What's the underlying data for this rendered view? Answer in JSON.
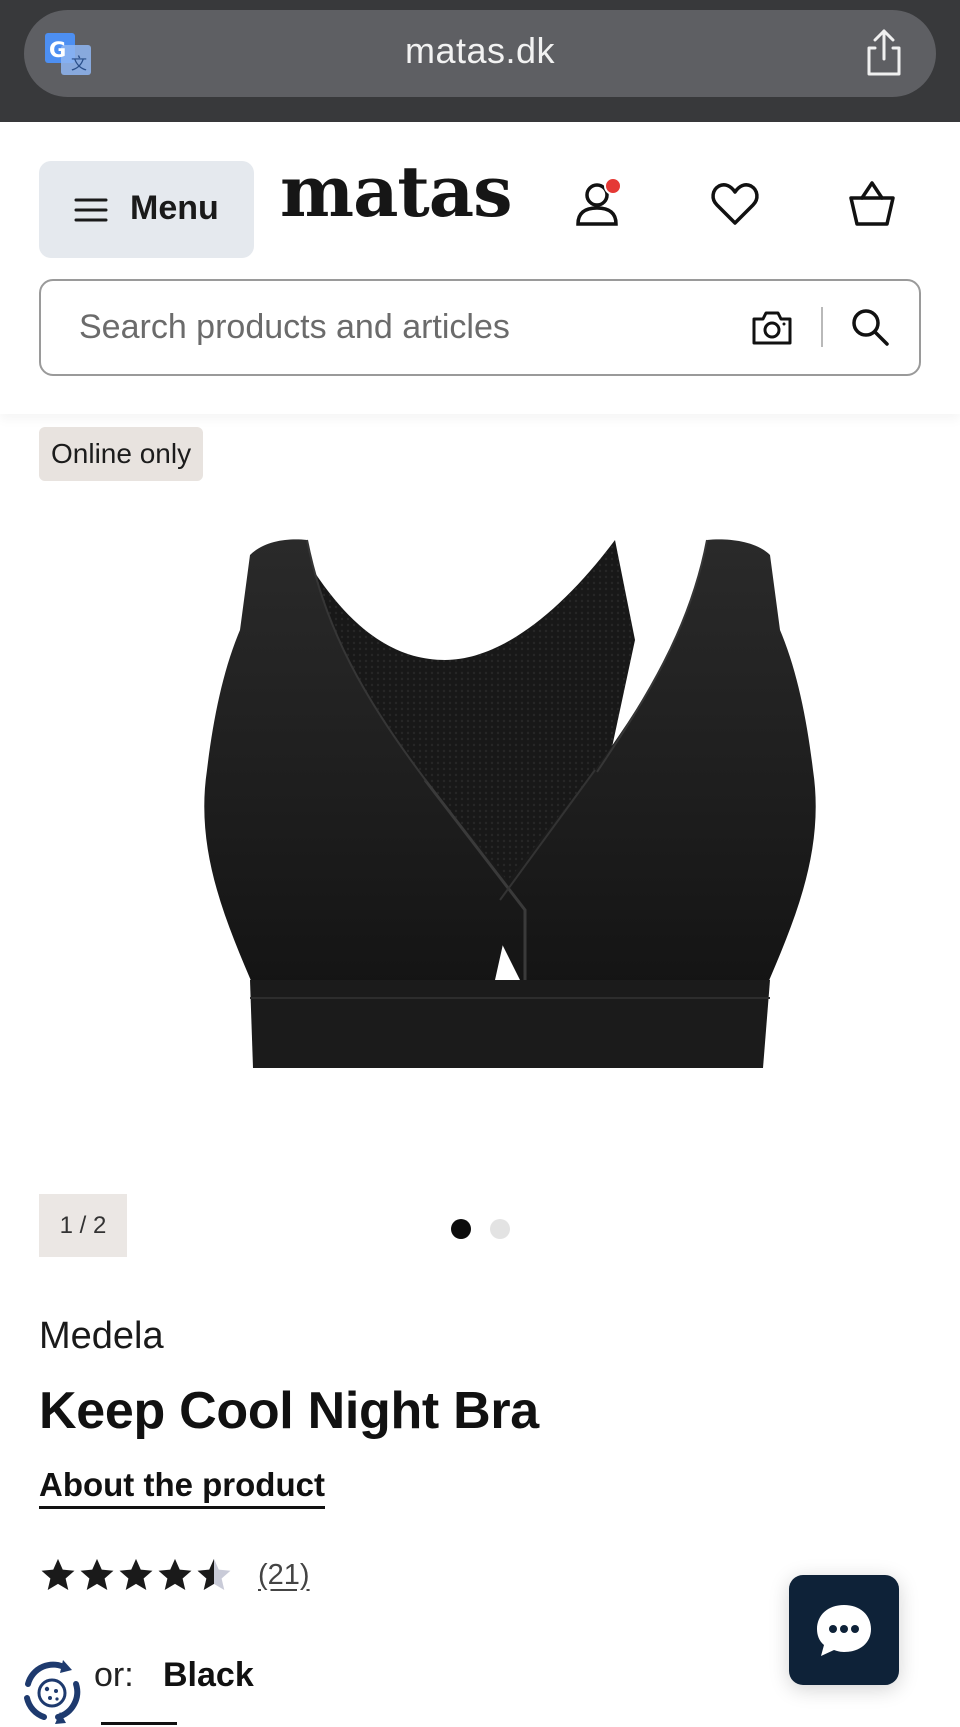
{
  "browser": {
    "url": "matas.dk"
  },
  "header": {
    "menu_label": "Menu",
    "logo_text": "matas",
    "account_notification_color": "#e53935"
  },
  "search": {
    "placeholder": "Search products and articles"
  },
  "product": {
    "badge": "Online only",
    "image_counter": "1 / 2",
    "carousel": {
      "current": 1,
      "total": 2
    },
    "brand": "Medela",
    "title": "Keep Cool Night Bra",
    "about_link": "About the product",
    "rating": {
      "value": 4.5,
      "max": 5,
      "review_count": "(21)"
    },
    "color_label": "or:",
    "color_value": "Black"
  },
  "colors": {
    "chat_button": "#0e2238",
    "badge_bg": "#e8e3df",
    "menu_bg": "#e5e9ee"
  }
}
